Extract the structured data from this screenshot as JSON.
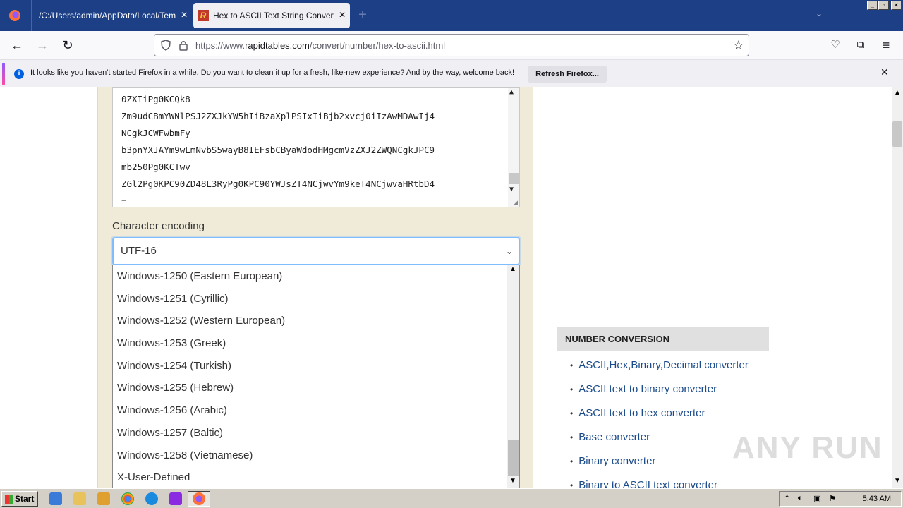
{
  "tabs": [
    {
      "title": "/C:/Users/admin/AppData/Local/Temp/i"
    },
    {
      "title": "Hex to ASCII Text String Converte"
    }
  ],
  "url": {
    "host_prefix": "https://www.",
    "host": "rapidtables.com",
    "path": "/convert/number/hex-to-ascii.html"
  },
  "notification": {
    "text": "It looks like you haven't started Firefox in a while. Do you want to clean it up for a fresh, like-new experience? And by the way, welcome back!",
    "button": "Refresh Firefox..."
  },
  "textarea_lines": [
    "0ZXIiPg0KCQk8",
    "Zm9udCBmYWNlPSJ2ZXJkYW5hIiBzaXplPSIxIiBjb2xvcj0iIzAwMDAwIj4",
    "NCgkJCWFwbmFy",
    "b3pnYXJAYm9wLmNvbS5wayB8IEFsbCByaWdodHMgcmVzZXJ2ZWQNCgkJPC9",
    "mb250Pg0KCTwv",
    "ZGl2Pg0KPC90ZD48L3RyPg0KPC90YWJsZT4NCjwvYm9keT4NCjwvaHRtbD4",
    "="
  ],
  "encoding": {
    "label": "Character encoding",
    "selected": "UTF-16",
    "options": [
      "Windows-1250 (Eastern European)",
      "Windows-1251 (Cyrillic)",
      "Windows-1252 (Western European)",
      "Windows-1253 (Greek)",
      "Windows-1254 (Turkish)",
      "Windows-1255 (Hebrew)",
      "Windows-1256 (Arabic)",
      "Windows-1257 (Baltic)",
      "Windows-1258 (Vietnamese)",
      "X-User-Defined"
    ]
  },
  "number_conversion": {
    "heading": "NUMBER CONVERSION",
    "links": [
      "ASCII,Hex,Binary,Decimal converter",
      "ASCII text to binary converter",
      "ASCII text to hex converter",
      "Base converter",
      "Binary converter",
      "Binary to ASCII text converter"
    ]
  },
  "watermark": "ANY RUN",
  "taskbar": {
    "start": "Start",
    "time": "5:43 AM"
  },
  "colors": {
    "tabstrip": "#1c3f86",
    "link": "#1a4a8a",
    "page_bg": "#f0ead8"
  }
}
